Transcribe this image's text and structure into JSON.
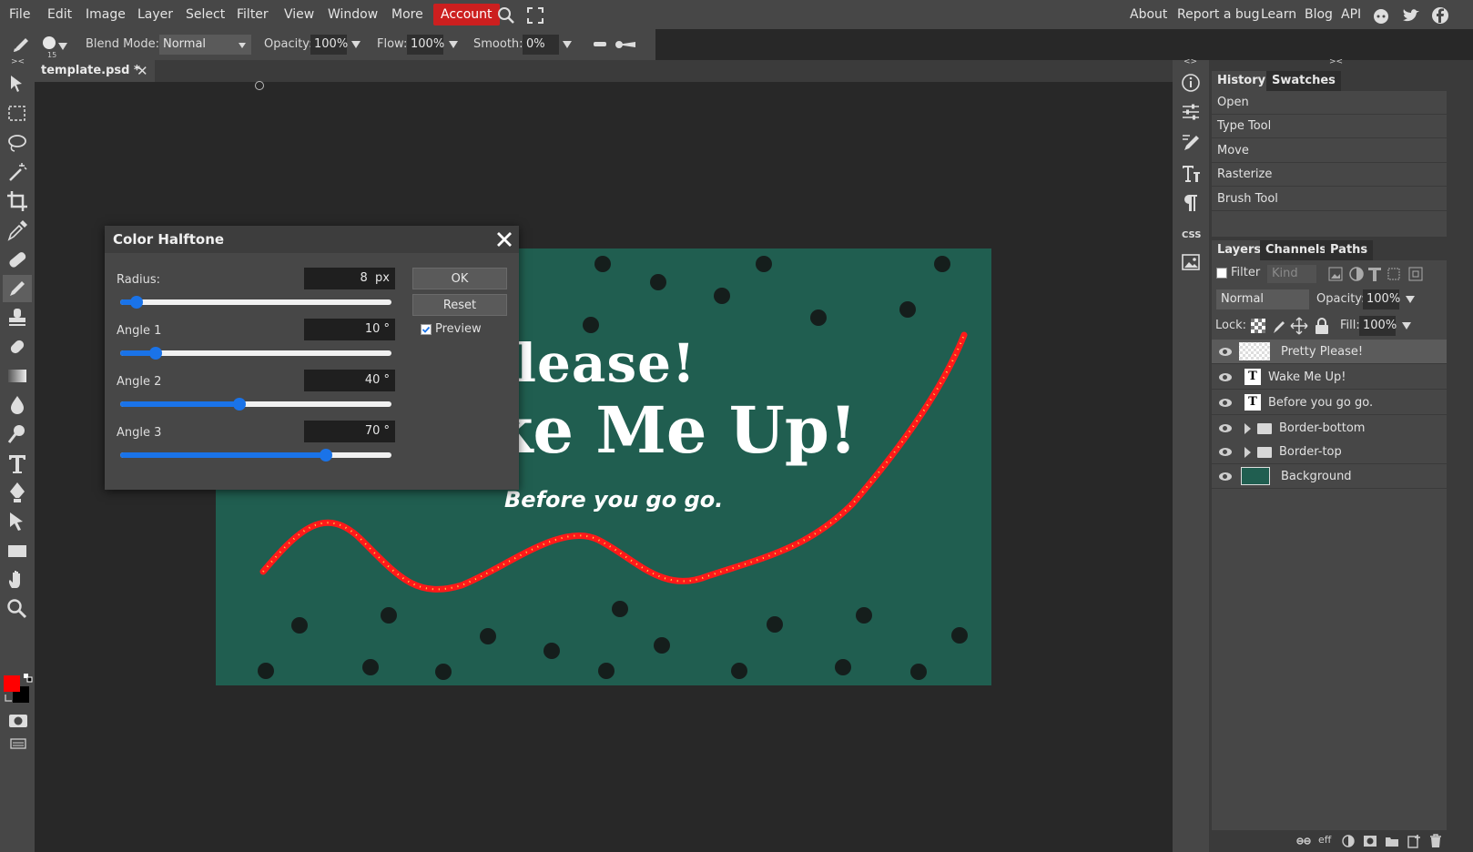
{
  "menubar": {
    "items": [
      "File",
      "Edit",
      "Image",
      "Layer",
      "Select",
      "Filter",
      "View",
      "Window",
      "More"
    ],
    "account": "Account",
    "right_links": [
      "About",
      "Report a bug",
      "Learn",
      "Blog",
      "API"
    ],
    "right_icons": [
      "reddit-icon",
      "twitter-icon",
      "facebook-icon"
    ]
  },
  "options": {
    "brush_size": "15",
    "blend_mode_label": "Blend Mode:",
    "blend_mode": "Normal",
    "opacity_label": "Opacity:",
    "opacity": "100%",
    "flow_label": "Flow:",
    "flow": "100%",
    "smooth_label": "Smooth:",
    "smooth": "0%"
  },
  "document": {
    "tab_title": "template.psd *",
    "canvas_background": "#205e50",
    "text_line1": "lease!",
    "text_line2": "ke Me Up!",
    "text_line3": "Before you go go."
  },
  "colors": {
    "foreground": "#ff0000",
    "background": "#000000",
    "accent": "#1a73e8"
  },
  "dialog": {
    "title": "Color Halftone",
    "radius_label": "Radius:",
    "radius_value": "8",
    "radius_unit": "px",
    "radius_fraction": 0.06,
    "angle1_label": "Angle 1",
    "angle1_value": "10 °",
    "angle1_fraction": 0.13,
    "angle2_label": "Angle 2",
    "angle2_value": "40 °",
    "angle2_fraction": 0.44,
    "angle3_label": "Angle 3",
    "angle3_value": "70 °",
    "angle3_fraction": 0.76,
    "ok": "OK",
    "reset": "Reset",
    "preview_label": "Preview",
    "preview_checked": true
  },
  "panels": {
    "history_tab": "History",
    "swatches_tab": "Swatches",
    "history": [
      "Open",
      "Type Tool",
      "Move",
      "Rasterize",
      "Brush Tool"
    ],
    "layers_tab": "Layers",
    "channels_tab": "Channels",
    "paths_tab": "Paths",
    "filter_label": "Filter",
    "kind_label": "Kind",
    "layer_blend": "Normal",
    "layer_opacity_label": "Opacity:",
    "layer_opacity": "100%",
    "lock_label": "Lock:",
    "fill_label": "Fill:",
    "fill": "100%",
    "layers": [
      {
        "name": "Pretty Please!",
        "type": "raster",
        "selected": true
      },
      {
        "name": "Wake Me Up!",
        "type": "text"
      },
      {
        "name": "Before you go go.",
        "type": "text"
      },
      {
        "name": "Border-bottom",
        "type": "folder"
      },
      {
        "name": "Border-top",
        "type": "folder"
      },
      {
        "name": "Background",
        "type": "raster"
      }
    ],
    "bottom_fx": "eff"
  },
  "iconcol": {
    "css_label": "CSS"
  }
}
